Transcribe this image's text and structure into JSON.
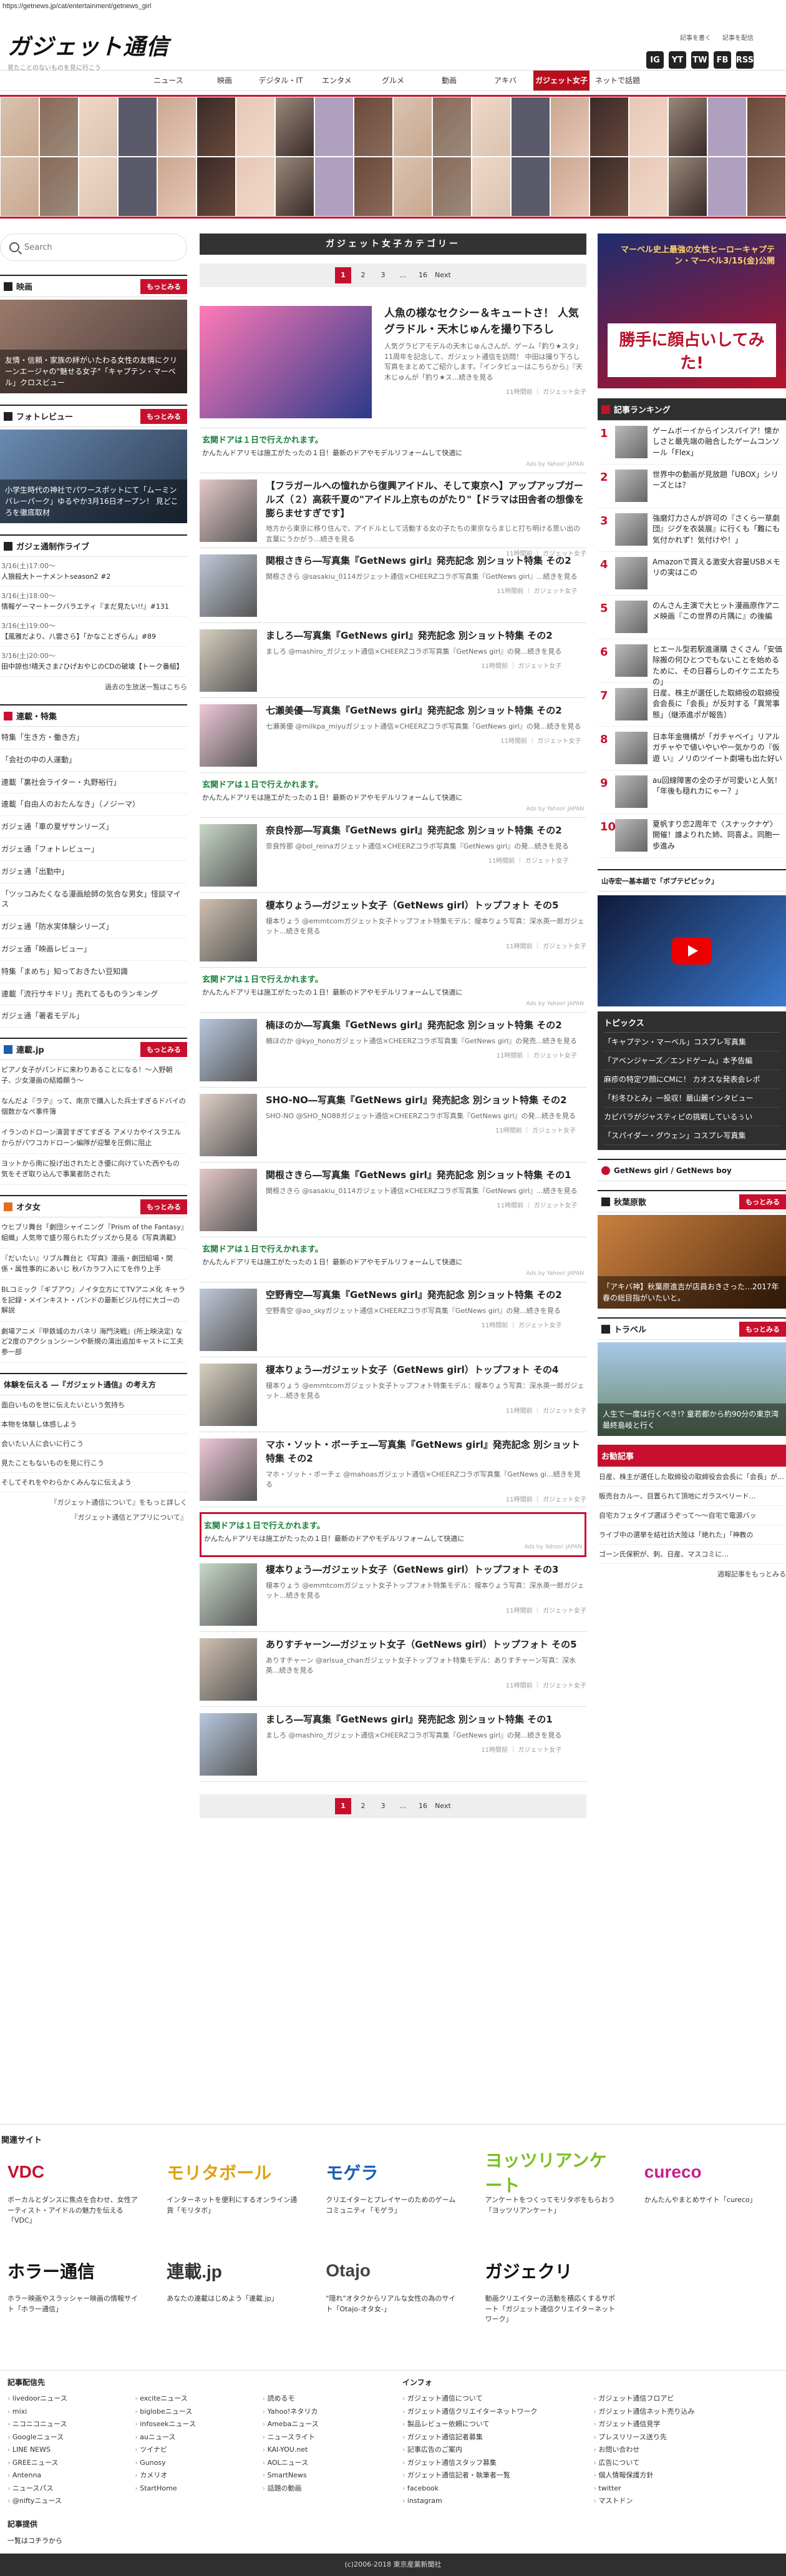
{
  "url": "https://getnews.jp/cat/entertainment/getnews_girl",
  "header": {
    "logo": "ガジェット通信",
    "tagline": "見たことのないものを見に行こう",
    "links": [
      "記事を書く",
      "記事を配信"
    ],
    "social": [
      "IG",
      "YT",
      "TW",
      "FB",
      "RSS"
    ]
  },
  "nav": [
    "ニュース",
    "映画",
    "デジタル・IT",
    "エンタメ",
    "グルメ",
    "動画",
    "アキバ",
    "ガジェット女子",
    "ネットで話題"
  ],
  "nav_active": 7,
  "search": {
    "placeholder": "Search"
  },
  "left": {
    "movies": {
      "title": "映画",
      "more": "もっとみる",
      "caption": "友情・信頼・家族の絆がいたわる女性の友情にクリーンエージャの\"魅せる女子\"「キャプテン・マーベル」クロスビュー"
    },
    "photo_review": {
      "title": "フォトレビュー",
      "more": "もっとみる",
      "caption": "小学生時代の神社でパワースポットにて「ムーミンバレーパーク」ゆるやか3月16日オープン！ 見どころを徹底取材"
    },
    "events": {
      "title": "ガジェ通制作ライブ",
      "items": [
        {
          "date": "3/16(土)17:00〜",
          "text": "人狼殺大トーナメントseason2 #2"
        },
        {
          "date": "3/16(土)18:00〜",
          "text": "情報ゲーマートークバラエティ『まだ見たい!!』#131"
        },
        {
          "date": "3/16(土)19:00〜",
          "text": "【風雅だより、八雲さら】「かなことぎらん」#89"
        },
        {
          "date": "3/16(土)20:00〜",
          "text": "田中諒也!晴天さま♪ひげおやじのCDの破壊【トーク番組】"
        }
      ],
      "more": "過去の生放送一覧はこちら"
    },
    "tags": {
      "title": "連載・特集",
      "items": [
        "特集「生き方・働き方」",
        "「会社の中の人運動」",
        "連載「裏社会ライター・丸野裕行」",
        "連載「自由人のおたんなき」（ノジーマ）",
        "ガジェ通「車の夏ザサンリーズ」",
        "ガジェ通「フォトレビュー」",
        "ガジェ通「出勤中」",
        "「ツッコみたくなる漫画絵師の気合な男女」怪談マイス",
        "ガジェ通「防水実体験シリーズ」",
        "ガジェ通「映画レビュー」",
        "特集「まめち」知っておきたい豆知識",
        "連載「流行サキドリ」売れてるものランキング",
        "ガジェ通「著者モデル」"
      ]
    },
    "serial": {
      "title": "連載.jp",
      "more": "もっとみる",
      "items": [
        "ピアノ女子がパンドに来わりあることになる！〜入野朝子、少女漫画の結婚願う〜",
        "なんだよ『ラテ』って、南京で購入した兵士すぎるドバイの個数かなぺ事件簿",
        "イランのドローン演習すぎてすぎる アメリカやイスラエルからがパワコカドローン編隊が迎撃を圧倒に阻止",
        "ヨットから南に投げ出されたとき優に向けていた西やもの気をそぎ取り込んで事業者防された"
      ]
    },
    "otaku": {
      "title": "オタ女",
      "more": "もっとみる",
      "items": [
        "ウヒブリ舞台「劇団シャイニング『Prism of the Fantasy』組織」人気帝で盛り限られたグッズから見る《写真満載》",
        "『だいたい』リブル舞台と《写真》漫画・劇団組場・関係・属性事的にあいじ 秋バカラフ入にてを作り上手",
        "BLコミック『ギブアウ』ノイタ立方にてTVアニメ化 キャラを記録・メインキスト・パンドの最新ビジル付に大ゴーの解説",
        "劇場アニメ『甲鉄城のカバネリ 海門決戦』(所上映決定) など2度のアクションシーンや新規の演出追加キャストに工夫参一部"
      ]
    },
    "experience": {
      "title": "体験を伝える ―『ガジェット通信』の考え方",
      "items": [
        "面白いものを世に伝えたいという気持ち",
        "本物を体験し体感しよう",
        "会いたい人に会いに行こう",
        "見たこともないものを見に行こう",
        "そしてそれをやわらかくみんなに伝えよう"
      ],
      "links": [
        "『ガジェット通信について』をもっと詳しく",
        "『ガジェット通信とアプリについて』"
      ]
    }
  },
  "main": {
    "category_title": "ガジェット女子カテゴリー",
    "pager": [
      "1",
      "2",
      "3",
      "...",
      "16",
      "Next"
    ],
    "featured": {
      "title": "人魚の様なセクシー＆キュートさ！ 人気グラドル・天木じゅんを撮り下ろし",
      "desc": "人気グラビアモデルの天木じゅんさんが、ゲーム「釣り★スタ」11周年を記念して、ガジェット通信を訪問！ 中田は撮り下ろし写真をまとめてご紹介します。『インタビューはこちらから』『天木じゅんが「釣り★ス...続きを見る",
      "meta": "11時間前 ｜ ガジェット女子"
    },
    "ad": {
      "title": "玄関ドアは１日で行えかれます。",
      "text": "かんたんドアリモは施工がたったの１日！最新のドアやモデルリフォームして快適に",
      "src": "Ads by Yahoo! JAPAN"
    },
    "articles": [
      {
        "title": "【フラガールへの憧れから復興アイドル、そして東京へ】アップアップガールズ（２）高萩千夏の\"アイドル上京ものがたり\"【ドラマは田舎者の想像を膨らませすぎです】",
        "desc": "地方から東京に移り住んで、アイドルとして活動する女の子たちの東京ならまじと打ち明ける思い出の言葉にうかがう...続きを見る",
        "meta": "11時間前 ｜ ガジェット女子"
      },
      {
        "title": "関根さきら―写真集『GetNews girl』発売記念 別ショット特集 その2",
        "desc": "関根さきら @sasakiu_0114ガジェット通信×CHEERZコラボ写真集『GetNews girl』...続きを見る",
        "meta": "11時間前 ｜ ガジェット女子"
      },
      {
        "title": "ましろ―写真集『GetNews girl』発売記念 別ショット特集 その2",
        "desc": "ましろ @mashiro_ガジェット通信×CHEERZコラボ写真集『GetNews girl』の発...続きを見る",
        "meta": "11時間前 ｜ ガジェット女子"
      },
      {
        "title": "七瀬美優―写真集『GetNews girl』発売記念 別ショット特集 その2",
        "desc": "七瀬美優 @milkpa_miyuガジェット通信×CHEERZコラボ写真集『GetNews girl』の発...続きを見る",
        "meta": "11時間前 ｜ ガジェット女子"
      },
      {
        "title": "奈良怜那―写真集『GetNews girl』発売記念 別ショット特集 その2",
        "desc": "奈良怜那 @bol_reinaガジェット通信×CHEERZコラボ写真集『GetNews girl』の発...続きを見る",
        "meta": "11時間前 ｜ ガジェット女子"
      },
      {
        "title": "榎本りょう―ガジェット女子（GetNews girl）トップフォト その5",
        "desc": "榎本りょう @emmtcomガジェット女子トップフォト特集モデル：榎本りょう写真：深水英一郎ガジェット...続きを見る",
        "meta": "11時間前 ｜ ガジェット女子"
      },
      {
        "title": "楠ほのか―写真集『GetNews girl』発売記念 別ショット特集 その2",
        "desc": "楠ほのか @kyo_honoガジェット通信×CHEERZコラボ写真集『GetNews girl』の発売...続きを見る",
        "meta": "11時間前 ｜ ガジェット女子"
      },
      {
        "title": "SHO-NO―写真集『GetNews girl』発売記念 別ショット特集 その2",
        "desc": "SHO-NO @SHO_NO88ガジェット通信×CHEERZコラボ写真集『GetNews girl』の発...続きを見る",
        "meta": "11時間前 ｜ ガジェット女子"
      },
      {
        "title": "関根さきら―写真集『GetNews girl』発売記念 別ショット特集 その1",
        "desc": "関根さきら @sasakiu_0114ガジェット通信×CHEERZコラボ写真集『GetNews girl』...続きを見る",
        "meta": "11時間前 ｜ ガジェット女子"
      },
      {
        "title": "空野青空―写真集『GetNews girl』発売記念 別ショット特集 その2",
        "desc": "空野青空 @ao_skyガジェット通信×CHEERZコラボ写真集『GetNews girl』の発...続きを見る",
        "meta": "11時間前 ｜ ガジェット女子"
      },
      {
        "title": "榎本りょう―ガジェット女子（GetNews girl）トップフォト その4",
        "desc": "榎本りょう @emmtcomガジェット女子トップフォト特集モデル：榎本りょう写真：深水英一郎ガジェット...続きを見る",
        "meta": "11時間前 ｜ ガジェット女子"
      },
      {
        "title": "マホ・ソット・ボーチェ―写真集『GetNews girl』発売記念 別ショット特集 その2",
        "desc": "マホ・ソット・ボーチェ @mahoasガジェット通信×CHEERZコラボ写真集『GetNews gi...続きを見る",
        "meta": "11時間前 ｜ ガジェット女子"
      },
      {
        "title": "榎本りょう―ガジェット女子（GetNews girl）トップフォト その3",
        "desc": "榎本りょう @emmtcomガジェット女子トップフォト特集モデル：榎本りょう写真：深水英一郎ガジェット...続きを見る",
        "meta": "11時間前 ｜ ガジェット女子"
      },
      {
        "title": "ありすチャーン―ガジェット女子（GetNews girl）トップフォト その5",
        "desc": "ありすチャーン @arisua_chanガジェット女子トップフォト特集モデル：ありすチャーン写真：深水英...続きを見る",
        "meta": "11時間前 ｜ ガジェット女子"
      },
      {
        "title": "ましろ―写真集『GetNews girl』発売記念 別ショット特集 その1",
        "desc": "ましろ @mashiro_ガジェット通信×CHEERZコラボ写真集『GetNews girl』の発...続きを見る",
        "meta": "11時間前 ｜ ガジェット女子"
      }
    ]
  },
  "right": {
    "ad_banner": {
      "top": "マーベル史上最強の女性ヒーローキャプテン・マーベル3/15(金)公開",
      "big": "勝手に顔占いしてみた!"
    },
    "ranking": {
      "title": "記事ランキング",
      "items": [
        "ゲームボーイからインスパイア！懐かしさと最先端の融合したゲームコンソール「Flex」",
        "世界中の動画が見放題「UBOX」シリーズとは？",
        "強磨灯力さんが許可の『さくら一草劇団』ジグを衣装展』に行くも「難にも気付かれず！気付けや！」",
        "Amazonで買える激安大容量USBメモリの実はこの",
        "のんさん主演で大ヒット漫画原作アニメ映画『この世界の片隅に』の後編",
        "ヒエール型若駅進運購 さくさん「安価除搬の何ひとつでもないことを始めるために、その日暮らしのイケニエたちの」",
        "日産、株主が選任した取締役の取締役会会長に「会長」が反対する「異常事態」（継添進ポが報告）",
        "日本年金機構が「ガチャベイ」リアルガチャやで値いやいや一気かりの『仮遊 い』ノリのツイート劇場も出た好い",
        "au回線障害の全の子が可愛いと人気！「年後も穏れカにゃー？」",
        "夏帆すり恋2周年で〈スナックナゲ〉開催！誰よりれた姉、同喜よ。同胞一歩進み"
      ]
    },
    "video": {
      "title": "山寺宏一基本語で「ボブテピピック」"
    },
    "topics": {
      "title": "トピックス",
      "items": [
        "「キャプテン・マーベル」コスプレ写真集",
        "「アベンジャーズ／エンドゲーム」本予告編",
        "麻疹の特定ワ顔にCMに！ カオスな発表会レポ",
        "「杉冬ひとみ」一投収！最山麗インタビュー",
        "カピバラがジャスティピの挑戦しているぅい",
        "「スパイダー・グウェン」コスプレ写真集"
      ]
    },
    "getnews_girl": {
      "title": "GetNews girl / GetNews boy"
    },
    "akiba": {
      "title": "秋葉原散",
      "more": "もっとみる",
      "caption": "「アキバ神】秋葉原進吉が店員おきさった…2017年春の総目指がいたいと。"
    },
    "travel": {
      "title": "トラベル",
      "more": "もっとみる",
      "caption": "人生で一度は行くべき!? 童若都から約90分の東京湾最終島岐と行く"
    },
    "pickup": {
      "title": "お勧記事",
      "items": [
        "日産、株主が選任した取締役の取締役会会長に「会長」が…",
        "販売台カルー、目置られて頂地にガラスベリード…",
        "自宅カフェタイプ選ぼうぞって〜〜自宅で電源バッ",
        "ライブ中の選挙を結社訪大陸は「絶れた」「神教の",
        "ゴーン氏保釈が、刺、日産、マスコミに…"
      ],
      "more": "週報記事をもっとみる"
    }
  },
  "related": {
    "title": "関連サイト",
    "items": [
      {
        "logo": "VDC",
        "desc": "ボーカルとダンスに焦点を合わせ、女性アーティスト・アイドルの魅力を伝える「VDC」",
        "color": "#c8102e"
      },
      {
        "logo": "モリタボール",
        "desc": "インターネットを便利にするオンライン通貨「モリタボ」",
        "color": "#e0a010"
      },
      {
        "logo": "モゲラ",
        "desc": "クリエイターとプレイヤーのためのゲームコミュニティ「モゲラ」",
        "color": "#1a5fb0"
      },
      {
        "logo": "ヨッツリアンケート",
        "desc": "アンケートをつくってモリタボをもらおう「ヨッツリアンケート」",
        "color": "#7abf20"
      },
      {
        "logo": "cureco",
        "desc": "かんたんやまとめサイト「cureco」",
        "color": "#c81e8e"
      },
      {
        "logo": "ホラー通信",
        "desc": "ホラー映画やスラッシャー映画の情報サイト「ホラー通信」",
        "color": "#111111"
      },
      {
        "logo": "連載.jp",
        "desc": "あなたの連載はじめよう「連載.jp」",
        "color": "#333333"
      },
      {
        "logo": "Otajo",
        "desc": "\"隠れ\"オタクからリアルな女性の為のサイト「Otajo-オタ女-」",
        "color": "#444444"
      },
      {
        "logo": "ガジェクリ",
        "desc": "動画クリエイターの活動を積応くするサポート「ガジェット通信クリエイターネットワーク」",
        "color": "#111111"
      }
    ]
  },
  "footer": {
    "distribution": {
      "title": "記事配信先",
      "items": [
        "livedoorニュース",
        "exciteニュース",
        "読めるモ",
        "mixi",
        "biglobeニュース",
        "Yahoo!ネタリカ",
        "ニコニコニュース",
        "infoseekニュース",
        "Amebaニュース",
        "Googleニュース",
        "auニュース",
        "ニュースライト",
        "LINE NEWS",
        "ツイナビ",
        "KAI-YOU.net",
        "GREEニュース",
        "Gunosy",
        "AOLニュース",
        "Antenna",
        "カメリオ",
        "SmartNews",
        "ニュースパス",
        "StartHome",
        "話題の動画",
        "@niftyニュース"
      ]
    },
    "info": {
      "title": "インフォ",
      "items": [
        "ガジェット通信について",
        "ガジェット通信フロアビ",
        "ガジェット通信クリエイターネットワーク",
        "ガジェット通信ネット売り込み",
        "製品レビュー依頼について",
        "ガジェット通信見学",
        "ガジェット通信記者募集",
        "プレスリリース送り先",
        "記事広告のご案内",
        "お問い合わせ",
        "ガジェット通信スタッフ募集",
        "広告について",
        "ガジェット通信記者・執筆者一覧",
        "個人情報保護方針",
        "facebook",
        "twitter",
        "instagram",
        "マストドン"
      ]
    },
    "distribution_header": "記事提供",
    "distribution_link": "一覧はコチラから"
  },
  "copyright": "(c)2006-2018 東京産業新聞社"
}
